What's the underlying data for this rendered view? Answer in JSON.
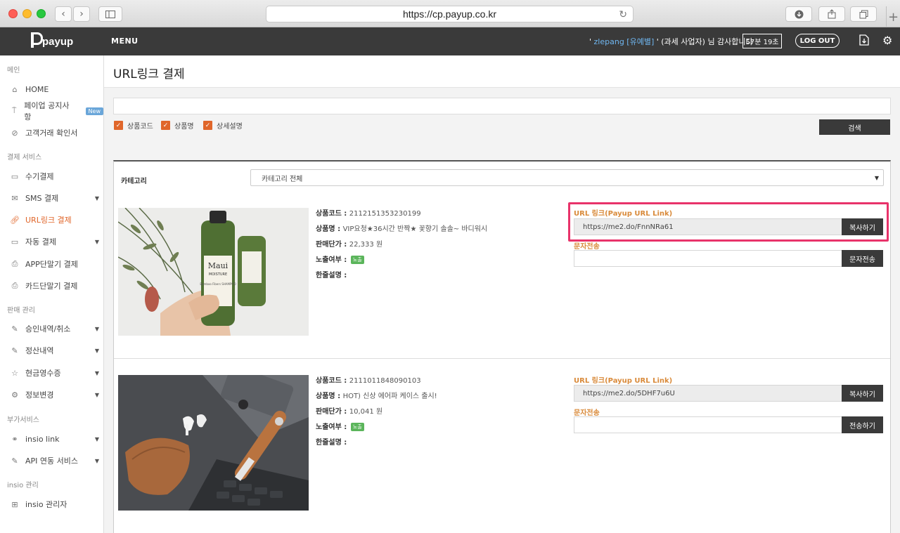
{
  "browser": {
    "url": "https://cp.payup.co.kr"
  },
  "header": {
    "logo_text": "payup",
    "menu_label": "MENU",
    "greeting_prefix": "' ",
    "greeting_user": "zlepang [유예별]",
    "greeting_suffix": " ' (과세 사업자) 님 감사합니다",
    "timer": "57분 19초",
    "logout": "LOG OUT"
  },
  "sidebar": {
    "sections": [
      {
        "title": "메인",
        "items": [
          {
            "label": "HOME",
            "icon": "home-icon"
          },
          {
            "label": "페이업 공지사항",
            "icon": "pin-icon",
            "badge": "New"
          },
          {
            "label": "고객거래 확인서",
            "icon": "check-circle-icon"
          }
        ]
      },
      {
        "title": "결제 서비스",
        "items": [
          {
            "label": "수기결제",
            "icon": "card-icon"
          },
          {
            "label": "SMS 결제",
            "icon": "mail-icon"
          },
          {
            "label": "URL링크 결제",
            "icon": "link-icon"
          },
          {
            "label": "자동 결제",
            "icon": "card-icon"
          },
          {
            "label": "APP단말기 결제",
            "icon": "print-icon"
          },
          {
            "label": "카드단말기 결제",
            "icon": "print-icon"
          }
        ]
      },
      {
        "title": "판매 관리",
        "items": [
          {
            "label": "승인내역/취소",
            "icon": "edit-icon"
          },
          {
            "label": "정산내역",
            "icon": "edit-icon"
          },
          {
            "label": "현금영수증",
            "icon": "star-icon"
          },
          {
            "label": "정보변경",
            "icon": "gear-icon"
          }
        ]
      },
      {
        "title": "부가서비스",
        "items": [
          {
            "label": "insio link",
            "icon": "link-icon"
          },
          {
            "label": "API 연동 서비스",
            "icon": "edit-icon"
          }
        ]
      },
      {
        "title": "insio 관리",
        "items": [
          {
            "label": "insio 관리자",
            "icon": "gift-icon"
          }
        ]
      }
    ]
  },
  "main": {
    "page_title": "URL링크 결제",
    "search": {
      "value": "",
      "filters": [
        "상품코드",
        "상품명",
        "상세설명"
      ],
      "button": "검색"
    },
    "category": {
      "label": "카테고리",
      "selected": "카테고리 전체"
    },
    "labels": {
      "code": "상품코드 : ",
      "name": "상품명 : ",
      "price": "판매단가 : ",
      "exposure": "노출여부 : ",
      "summary": "한줄설명 : ",
      "url_link": "URL 링크(Payup URL Link)",
      "sms": "문자전송"
    },
    "products": [
      {
        "code": "2112151353230199",
        "name": "VIP요청★36시간 반짝★ 꽃향기 솔솔~ 바디워시",
        "price": "22,333 원",
        "exposure": "노출",
        "summary": "",
        "url": "https://me2.do/FnnNRa61",
        "copy_button": "복사하기",
        "sms_button": "문자전송",
        "image_text_brand": "Maui",
        "image_text_sub": "MOISTURE",
        "image_text_product": "Bamboo Fibers SHAMPOO"
      },
      {
        "code": "2111011848090103",
        "name": "HOT) 신상 에어파 케이스 출시!",
        "price": "10,041 원",
        "exposure": "노출",
        "summary": "",
        "url": "https://me2.do/5DHF7u6U",
        "copy_button": "복사하기",
        "sms_button": "전송하기"
      }
    ]
  }
}
